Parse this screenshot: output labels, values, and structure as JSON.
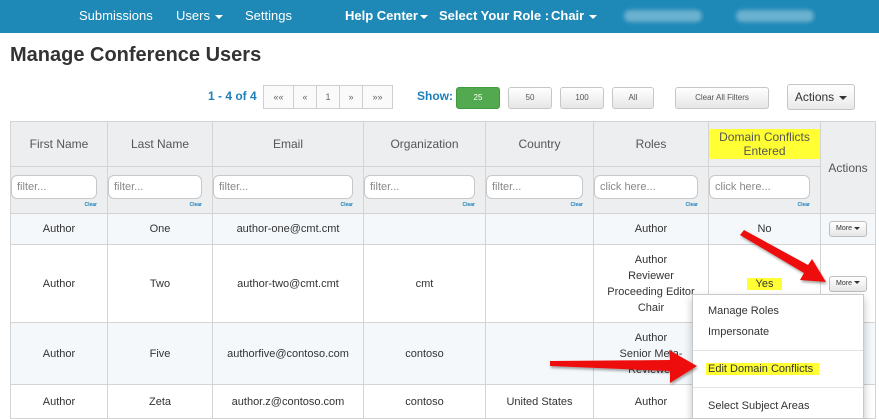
{
  "nav": {
    "submissions": "Submissions",
    "users": "Users",
    "settings": "Settings",
    "help_center": "Help Center",
    "select_role_label": "Select Your Role :",
    "role": "Chair"
  },
  "page": {
    "title": "Manage Conference Users"
  },
  "toolbar": {
    "range": "1 - 4 of 4",
    "pager": [
      "««",
      "«",
      "1",
      "»",
      "»»"
    ],
    "show_label": "Show:",
    "page_sizes": [
      "25",
      "50",
      "100",
      "All"
    ],
    "active_page_size": "25",
    "clear_filters": "Clear All Filters",
    "actions": "Actions"
  },
  "table": {
    "columns": [
      "First Name",
      "Last Name",
      "Email",
      "Organization",
      "Country",
      "Roles",
      "Domain Conflicts Entered",
      "Actions"
    ],
    "filters": {
      "placeholder": "filter...",
      "roles_placeholder": "click here...",
      "clear": "Clear"
    },
    "rows": [
      {
        "first": "Author",
        "last": "One",
        "email": "author-one@cmt.cmt",
        "org": "",
        "country": "",
        "roles": [
          "Author"
        ],
        "conflicts": "No",
        "action": "More"
      },
      {
        "first": "Author",
        "last": "Two",
        "email": "author-two@cmt.cmt",
        "org": "cmt",
        "country": "",
        "roles": [
          "Author",
          "Reviewer",
          "Proceeding Editor",
          "Chair"
        ],
        "conflicts": "Yes",
        "action": "More"
      },
      {
        "first": "Author",
        "last": "Five",
        "email": "authorfive@contoso.com",
        "org": "contoso",
        "country": "",
        "roles": [
          "Author",
          "Senior Meta-",
          "Reviewer"
        ],
        "conflicts": "",
        "action": ""
      },
      {
        "first": "Author",
        "last": "Zeta",
        "email": "author.z@contoso.com",
        "org": "contoso",
        "country": "United States",
        "roles": [
          "Author"
        ],
        "conflicts": "",
        "action": ""
      }
    ]
  },
  "menu": {
    "items": [
      "Manage Roles",
      "Impersonate",
      "Edit Domain Conflicts",
      "Select Subject Areas"
    ]
  },
  "colors": {
    "nav": "#1e88b6",
    "highlight": "#ffff33",
    "arrow": "#ee1111",
    "active_size": "#53a94f"
  }
}
